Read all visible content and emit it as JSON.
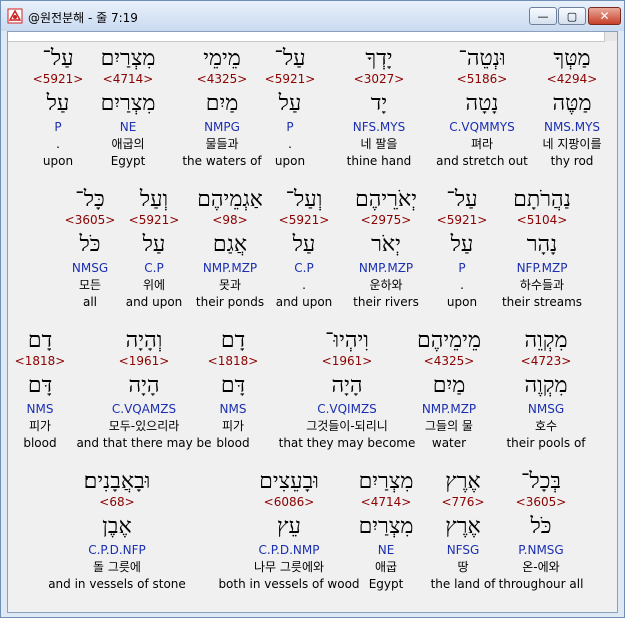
{
  "window": {
    "title": "@원전분해 - 줄 7:19",
    "minimize_glyph": "—",
    "maximize_glyph": "▢",
    "close_glyph": "✕"
  },
  "rows": [
    [
      {
        "heb": "מַטְּךָ",
        "num": "<4294>",
        "lemma": "מַטֶּה",
        "morph": "NMS.MYS",
        "kor": "네 지팡이를",
        "eng": "thy rod"
      },
      {
        "heb": "וּנְטֵה־",
        "num": "<5186>",
        "lemma": "נָטָה",
        "morph": "C.VQMMYS",
        "kor": "펴라",
        "eng": "and stretch out"
      },
      {
        "heb": "יָדְךָ",
        "num": "<3027>",
        "lemma": "יָד",
        "morph": "NFS.MYS",
        "kor": "네 팔을",
        "eng": "thine hand"
      },
      {
        "heb": "עַל־",
        "num": "<5921>",
        "lemma": "עַל",
        "morph": "P",
        "kor": ".",
        "eng": "upon"
      },
      {
        "heb": "מֵימֵי",
        "num": "<4325>",
        "lemma": "מַיִם",
        "morph": "NMPG",
        "kor": "물들과",
        "eng": "the waters of"
      },
      {
        "heb": "מִצְרַיִם",
        "num": "<4714>",
        "lemma": "מִצְרַיִם",
        "morph": "NE",
        "kor": "애굽의",
        "eng": "Egypt"
      },
      {
        "heb": "עַל־",
        "num": "<5921>",
        "lemma": "עַל",
        "morph": "P",
        "kor": ".",
        "eng": "upon"
      }
    ],
    [
      {
        "heb": "נַהֲרֹתָם",
        "num": "<5104>",
        "lemma": "נָהָר",
        "morph": "NFP.MZP",
        "kor": "하수들과",
        "eng": "their streams"
      },
      {
        "heb": "עַל־",
        "num": "<5921>",
        "lemma": "עַל",
        "morph": "P",
        "kor": ".",
        "eng": "upon"
      },
      {
        "heb": "יְאֹרֵיהֶם",
        "num": "<2975>",
        "lemma": "יְאֹר",
        "morph": "NMP.MZP",
        "kor": "운하와",
        "eng": "their rivers"
      },
      {
        "heb": "וְעַל־",
        "num": "<5921>",
        "lemma": "עַל",
        "morph": "C.P",
        "kor": ".",
        "eng": "and upon"
      },
      {
        "heb": "אַגְמֵיהֶם",
        "num": "<98>",
        "lemma": "אֲגַם",
        "morph": "NMP.MZP",
        "kor": "못과",
        "eng": "their ponds"
      },
      {
        "heb": "וְעַל",
        "num": "<5921>",
        "lemma": "עַל",
        "morph": "C.P",
        "kor": "위에",
        "eng": "and upon"
      },
      {
        "heb": "כָּל־",
        "num": "<3605>",
        "lemma": "כֹּל",
        "morph": "NMSG",
        "kor": "모든",
        "eng": "all"
      }
    ],
    [
      {
        "heb": "מִקְוֵה",
        "num": "<4723>",
        "lemma": "מִקְוֶה",
        "morph": "NMSG",
        "kor": "호수",
        "eng": "their pools of"
      },
      {
        "heb": "מֵימֵיהֶם",
        "num": "<4325>",
        "lemma": "מַיִם",
        "morph": "NMP.MZP",
        "kor": "그들의 물",
        "eng": "water"
      },
      {
        "heb": "וִיהְיוּ־",
        "num": "<1961>",
        "lemma": "הָיָה",
        "morph": "C.VQIMZS",
        "kor": "그것들이-되리니",
        "eng": "that they may become"
      },
      {
        "heb": "דָם",
        "num": "<1818>",
        "lemma": "דָּם",
        "morph": "NMS",
        "kor": "피가",
        "eng": "blood"
      },
      {
        "heb": "וְהָיָה",
        "num": "<1961>",
        "lemma": "הָיָה",
        "morph": "C.VQAMZS",
        "kor": "모두-있으리라",
        "eng": "and that there may be"
      },
      {
        "heb": "דָם",
        "num": "<1818>",
        "lemma": "דָּם",
        "morph": "NMS",
        "kor": "피가",
        "eng": "blood"
      }
    ],
    [
      {
        "heb": "בְּכָל־",
        "num": "<3605>",
        "lemma": "כֹּל",
        "morph": "P.NMSG",
        "kor": "온-에와",
        "eng": "throughour all"
      },
      {
        "heb": "אֶרֶץ",
        "num": "<776>",
        "lemma": "אֶרֶץ",
        "morph": "NFSG",
        "kor": "땅",
        "eng": "the land of"
      },
      {
        "heb": "מִצְרַיִם",
        "num": "<4714>",
        "lemma": "מִצְרַיִם",
        "morph": "NE",
        "kor": "애굽",
        "eng": "Egypt"
      },
      {
        "heb": "וּבָעֵצִים",
        "num": "<6086>",
        "lemma": "עֵץ",
        "morph": "C.P.D.NMP",
        "kor": "나무 그릇에와",
        "eng": "both in vessels of wood"
      },
      {
        "heb": "וּבָאֲבָנִים׃",
        "num": "<68>",
        "lemma": "אֶבֶן",
        "morph": "C.P.D.NFP",
        "kor": "돌 그릇에",
        "eng": "and in vessels of stone"
      }
    ]
  ]
}
